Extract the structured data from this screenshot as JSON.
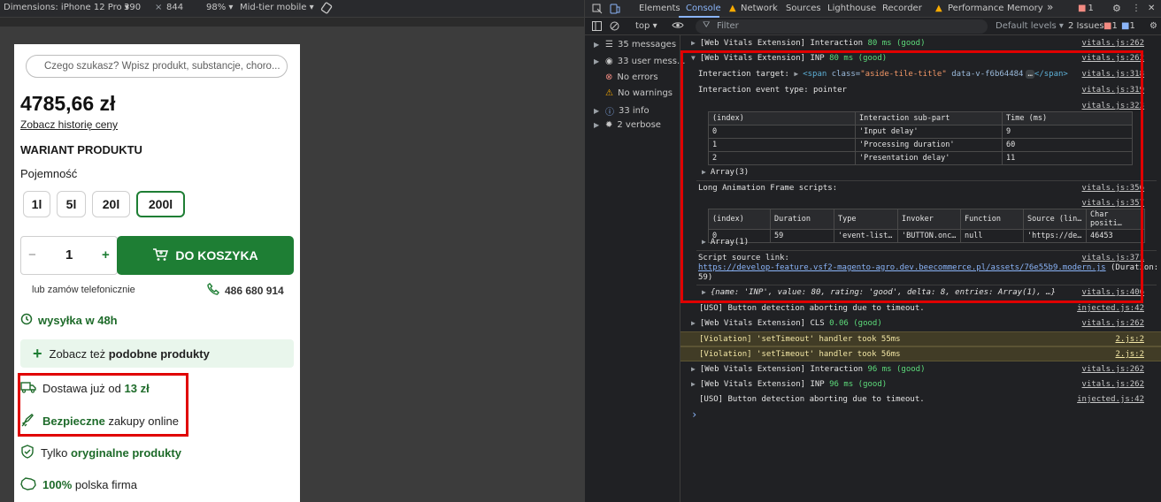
{
  "device_toolbar": {
    "dimensions": "Dimensions: iPhone 12 Pro ▾",
    "width": "390",
    "times": "×",
    "height": "844",
    "zoom": "98% ▾",
    "throttle": "Mid-tier mobile ▾"
  },
  "page": {
    "search_placeholder": "Czego szukasz? Wpisz produkt, substancje, choro...",
    "price": "4785,66 zł",
    "price_history": "Zobacz historię ceny",
    "variant_title": "WARIANT PRODUKTU",
    "capacity_label": "Pojemność",
    "variants": [
      "1l",
      "5l",
      "20l",
      "200l"
    ],
    "selected_variant": "200l",
    "qty_minus": "−",
    "qty_value": "1",
    "qty_plus": "+",
    "add_to_cart": "DO KOSZYKA",
    "phone_order": "lub zamów telefonicznie",
    "phone_number": "486 680 914",
    "shipping": "wysyłka w 48h",
    "similar_prefix": "Zobacz też",
    "similar_bold": "podobne produkty",
    "delivery_prefix": "Dostawa już od",
    "delivery_bold": "13 zł",
    "safe_bold": "Bezpieczne",
    "safe_suffix": "zakupy online",
    "original_prefix": "Tylko",
    "original_bold": "oryginalne produkty",
    "polish_bold": "100%",
    "polish_suffix": "polska firma",
    "accent_color": "#1e7e34"
  },
  "devtools": {
    "tabs": [
      "Elements",
      "Console",
      "Network",
      "Sources",
      "Lighthouse",
      "Recorder",
      "Performance",
      "Memory"
    ],
    "active_tab": "Console",
    "more_tabs": "»",
    "issues_badge": "1",
    "info_badge": "1",
    "context": "top ▾",
    "filter_placeholder": "Filter",
    "levels": "Default levels ▾",
    "issues_count": "2 Issues:",
    "issues_err": "1",
    "issues_info": "1",
    "sidebar": [
      {
        "label": "35 messages",
        "icon": "list-icon"
      },
      {
        "label": "33 user mess...",
        "icon": "user-icon"
      },
      {
        "label": "No errors",
        "icon": "error-icon"
      },
      {
        "label": "No warnings",
        "icon": "warning-icon"
      },
      {
        "label": "33 info",
        "icon": "info-icon"
      },
      {
        "label": "2 verbose",
        "icon": "bug-icon"
      }
    ],
    "log": {
      "l1_prefix": "[Web Vitals Extension] Interaction ",
      "l1_good": "80 ms (good)",
      "l1_link": "vitals.js:262",
      "l2_prefix": "[Web Vitals Extension] INP ",
      "l2_good": "80 ms (good)",
      "l2_link": "vitals.js:262",
      "target_label": "Interaction target: ",
      "target_tag_open": "<span",
      "target_attr": "class=",
      "target_val": "\"aside-tile-title\"",
      "target_attr2": "data-v-f6b64484",
      "target_ellipsis": "…",
      "target_tag_close": "</span>",
      "target_link": "vitals.js:318",
      "event_type": "Interaction event type: pointer",
      "event_link": "vitals.js:319",
      "table1_link": "vitals.js:323",
      "table1_headers": [
        "(index)",
        "Interaction sub-part",
        "Time (ms)"
      ],
      "table1_rows": [
        [
          "0",
          "'Input delay'",
          "9"
        ],
        [
          "1",
          "'Processing duration'",
          "60"
        ],
        [
          "2",
          "'Presentation delay'",
          "11"
        ]
      ],
      "table1_array": "Array(3)",
      "laf_label": "Long Animation Frame scripts:",
      "laf_link": "vitals.js:356",
      "table2_link": "vitals.js:357",
      "table2_headers": [
        "(index)",
        "Duration",
        "Type",
        "Invoker",
        "Function",
        "Source (lin…",
        "Char positi…"
      ],
      "table2_row": [
        "0",
        "59",
        "'event-list…",
        "'BUTTON.onc…",
        "null",
        "'https://de…",
        "46453"
      ],
      "table2_array": "Array(1)",
      "script_label": "Script source link:",
      "script_link": "vitals.js:371",
      "script_url": "https://develop-feature.vsf2-magento-agro.dev.beecommerce.pl/assets/76e55b9.modern.js",
      "script_duration": " (Duration:",
      "script_duration2": "59)",
      "obj_summary": "{name: 'INP', value: 80, rating: 'good', delta: 8, entries: Array(1), …}",
      "obj_link": "vitals.js:406",
      "uso1": "[USO] Button detection aborting due to timeout.",
      "uso1_link": "injected.js:42",
      "cls_prefix": "[Web Vitals Extension] CLS ",
      "cls_good": "0.06 (good)",
      "cls_link": "vitals.js:262",
      "viol1": "[Violation] 'setTimeout' handler took 55ms",
      "viol1_link": "2.js:2",
      "viol2": "[Violation] 'setTimeout' handler took 56ms",
      "viol2_link": "2.js:2",
      "l3_prefix": "[Web Vitals Extension] Interaction ",
      "l3_good": "96 ms (good)",
      "l3_link": "vitals.js:262",
      "l4_prefix": "[Web Vitals Extension] INP ",
      "l4_good": "96 ms (good)",
      "l4_link": "vitals.js:262",
      "uso2": "[USO] Button detection aborting due to timeout.",
      "uso2_link": "injected.js:42",
      "prompt": "›"
    }
  }
}
